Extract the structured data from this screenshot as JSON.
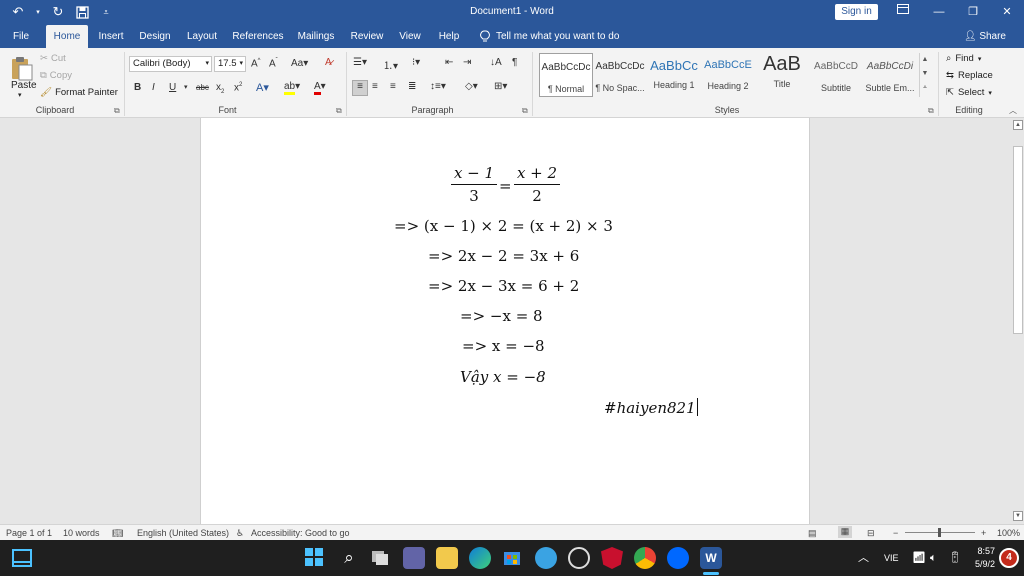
{
  "titlebar": {
    "doc_title": "Document1 - Word",
    "sign_in": "Sign in"
  },
  "tabs": [
    "File",
    "Home",
    "Insert",
    "Design",
    "Layout",
    "References",
    "Mailings",
    "Review",
    "View",
    "Help"
  ],
  "tell_me": "Tell me what you want to do",
  "share": "Share",
  "clipboard": {
    "paste": "Paste",
    "cut": "Cut",
    "copy": "Copy",
    "format_painter": "Format Painter",
    "label": "Clipboard"
  },
  "font": {
    "name": "Calibri (Body)",
    "size": "17.5",
    "label": "Font"
  },
  "paragraph": {
    "label": "Paragraph"
  },
  "styles": {
    "items": [
      {
        "preview": "AaBbCcDc",
        "name": "¶ Normal"
      },
      {
        "preview": "AaBbCcDc",
        "name": "¶ No Spac..."
      },
      {
        "preview": "AaBbCc",
        "name": "Heading 1"
      },
      {
        "preview": "AaBbCcE",
        "name": "Heading 2"
      },
      {
        "preview": "AaB",
        "name": "Title"
      },
      {
        "preview": "AaBbCcD",
        "name": "Subtitle"
      },
      {
        "preview": "AaBbCcDi",
        "name": "Subtle Em..."
      }
    ],
    "label": "Styles"
  },
  "editing": {
    "find": "Find",
    "replace": "Replace",
    "select": "Select",
    "label": "Editing"
  },
  "document": {
    "fraction_left": {
      "num": "x − 1",
      "den": "3"
    },
    "fraction_right": {
      "num": "x + 2",
      "den": "2"
    },
    "equals": "=",
    "lines": [
      "=> (x − 1) × 2 = (x + 2) × 3",
      "=> 2x − 2 = 3x + 6",
      "=> 2x − 3x = 6 + 2",
      "=>  −x = 8",
      "=> x = −8",
      "Vậy x = −8"
    ],
    "signature": "#haiyen821"
  },
  "status": {
    "page": "Page 1 of 1",
    "words": "10 words",
    "language": "English (United States)",
    "accessibility": "Accessibility: Good to go",
    "zoom": "100%"
  },
  "taskbar": {
    "lang": "VIE",
    "time": "8:57",
    "date": "5/9/2",
    "notifications": "4"
  },
  "colors": {
    "word_blue": "#2b579a",
    "ribbon_bg": "#f3f3f3",
    "taskbar_bg": "#1f1f1f"
  }
}
